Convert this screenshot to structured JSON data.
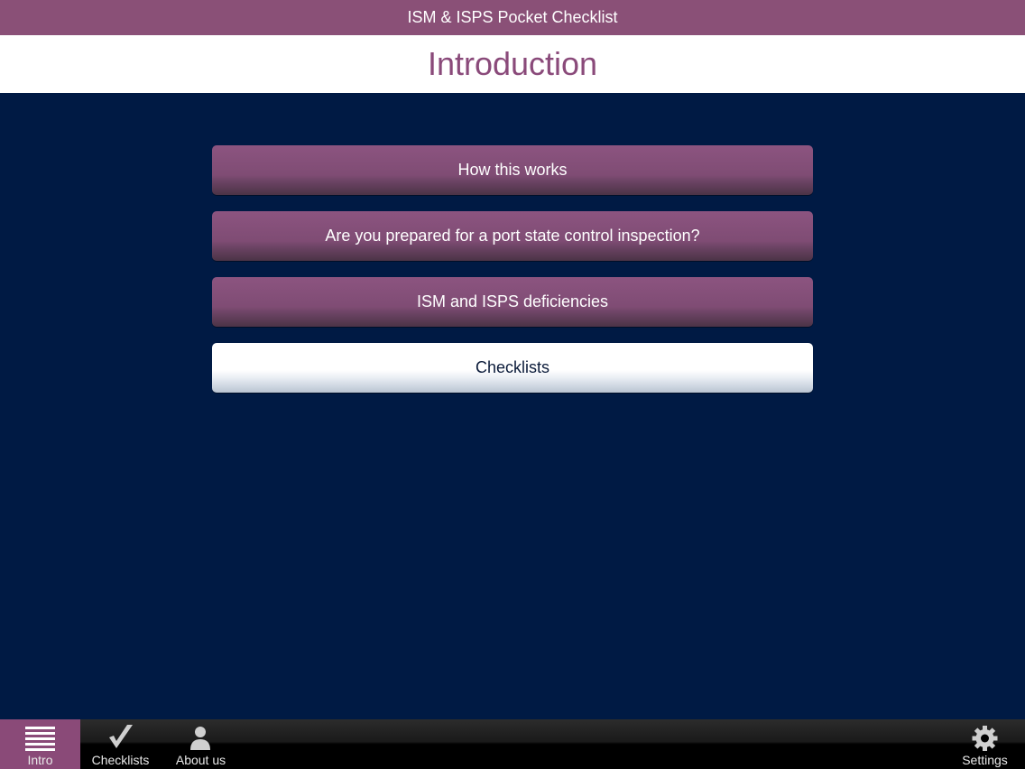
{
  "app": {
    "title": "ISM & ISPS Pocket Checklist"
  },
  "header": {
    "title": "Introduction"
  },
  "menu": {
    "items": [
      {
        "label": "How this works"
      },
      {
        "label": "Are you prepared for a port state control inspection?"
      },
      {
        "label": "ISM and ISPS deficiencies"
      },
      {
        "label": "Checklists"
      }
    ]
  },
  "tabbar": {
    "tabs": [
      {
        "label": "Intro",
        "icon": "list-lines-icon",
        "active": true
      },
      {
        "label": "Checklists",
        "icon": "checkmark-icon",
        "active": false
      },
      {
        "label": "About us",
        "icon": "person-icon",
        "active": false
      },
      {
        "label": "Settings",
        "icon": "gear-icon",
        "active": false
      }
    ]
  },
  "colors": {
    "accent": "#8a5077",
    "background": "#001a44",
    "header_text": "#8a4a7a"
  }
}
